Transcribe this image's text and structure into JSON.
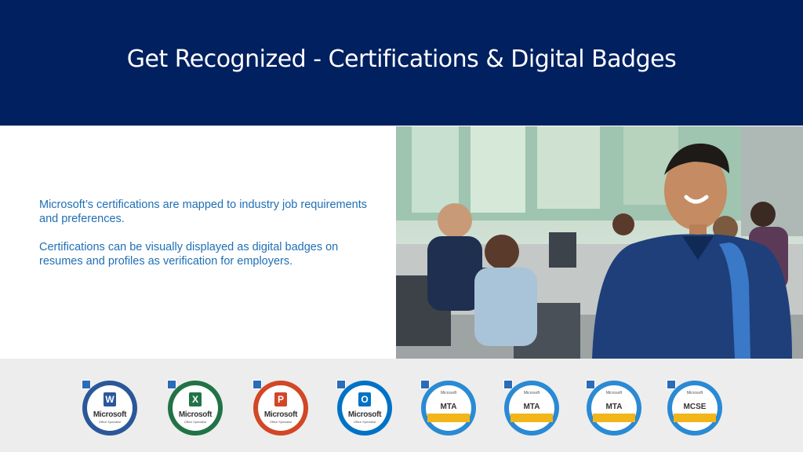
{
  "slide": {
    "title": "Get Recognized - Certifications & Digital Badges",
    "paragraphs": [
      "Microsoft’s certifications are mapped to industry job requirements and preferences.",
      "Certifications can be visually displayed as digital badges on resumes and profiles as verification for employers."
    ]
  },
  "colors": {
    "header_bg": "#002060",
    "body_text": "#1f6fb5",
    "badge_strip": "#ededed"
  },
  "badges": [
    {
      "kind": "office",
      "app": "word",
      "letter": "W",
      "color": "#2b579a",
      "brand": "Microsoft",
      "sub": "Office Specialist"
    },
    {
      "kind": "office",
      "app": "excel",
      "letter": "X",
      "color": "#217346",
      "brand": "Microsoft",
      "sub": "Office Specialist"
    },
    {
      "kind": "office",
      "app": "powerpoint",
      "letter": "P",
      "color": "#d24726",
      "brand": "Microsoft",
      "sub": "Office Specialist"
    },
    {
      "kind": "office",
      "app": "outlook",
      "letter": "O",
      "color": "#0072c6",
      "brand": "Microsoft",
      "sub": "Office Specialist"
    },
    {
      "kind": "cert",
      "ms": "Microsoft",
      "code": "MTA",
      "color": "#2a8ad4"
    },
    {
      "kind": "cert",
      "ms": "Microsoft",
      "code": "MTA",
      "color": "#2a8ad4"
    },
    {
      "kind": "cert",
      "ms": "Microsoft",
      "code": "MTA",
      "color": "#2a8ad4"
    },
    {
      "kind": "cert",
      "ms": "Microsoft",
      "code": "MCSE",
      "color": "#2a8ad4"
    }
  ]
}
